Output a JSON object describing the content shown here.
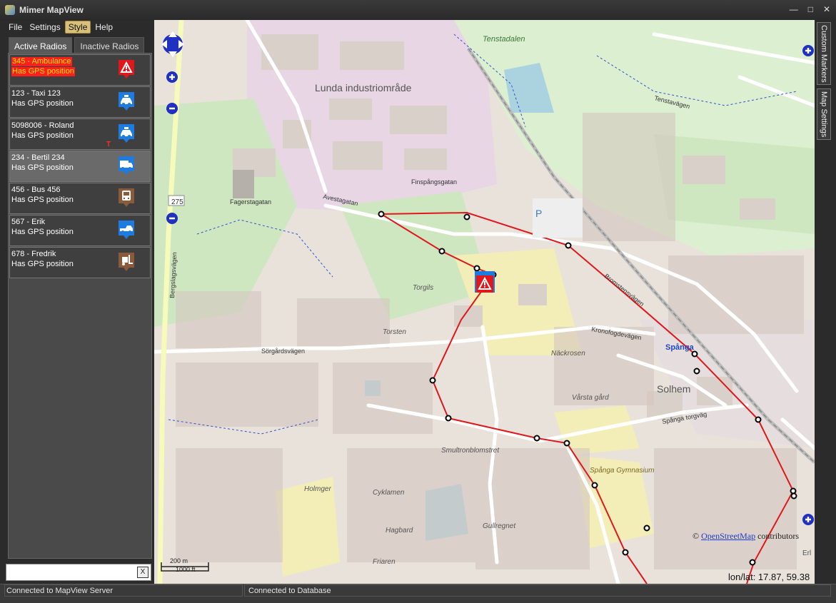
{
  "window": {
    "title": "Mimer MapView",
    "min_label": "—",
    "max_label": "□",
    "close_label": "✕"
  },
  "menu": {
    "file": "File",
    "settings": "Settings",
    "style": "Style",
    "help": "Help"
  },
  "tabs": {
    "active": "Active Radios",
    "inactive": "Inactive Radios"
  },
  "radios": [
    {
      "name": "345 - Ambulance",
      "status": "Has GPS position",
      "icon": "alarm-warning-icon",
      "alarm": true
    },
    {
      "name": "123 - Taxi 123",
      "status": "Has GPS position",
      "icon": "taxi-icon"
    },
    {
      "name": "5098006 - Roland",
      "status": "Has GPS position",
      "icon": "taxi-icon",
      "flag": "T"
    },
    {
      "name": "234 - Bertil 234",
      "status": "Has GPS position",
      "icon": "truck-icon",
      "selected": true
    },
    {
      "name": "456 - Bus 456",
      "status": "Has GPS position",
      "icon": "bus-icon"
    },
    {
      "name": "567 - Erik",
      "status": "Has GPS position",
      "icon": "pickup-icon"
    },
    {
      "name": "678 - Fredrik",
      "status": "Has GPS position",
      "icon": "forklift-icon"
    }
  ],
  "search": {
    "value": "",
    "clear_label": "X"
  },
  "map": {
    "labels": {
      "lunda": "Lunda industriområde",
      "tenstadalen": "Tenstadalen",
      "solhem": "Solhem",
      "spanga": "Spånga",
      "bergslagsvagen": "Bergslagsvägen",
      "avestagatan": "Avestagatan",
      "fagerstagatan": "Fagerstagatan",
      "finspangsgatan": "Finspångsgatan",
      "sorgardsvagen": "Sörgårdsvägen",
      "kronofogdevagen": "Kronofogdevägen",
      "tenstavagen": "Tenstavägen",
      "spanga_torgvag": "Spånga torgväg",
      "torsten": "Torsten",
      "torgils": "Torgils",
      "nackrosen": "Näckrosen",
      "vorsta_gard": "Vårsta gård",
      "smultronblomstret": "Smultronblomstret",
      "cyklamen": "Cyklamen",
      "holmger": "Holmger",
      "gullregnet": "Gullregnet",
      "hagbard": "Hagbard",
      "friaren": "Friaren",
      "spanga_gymnasium": "Spånga Gymnasium",
      "bromstensvagen": "Bromstensvägen",
      "road_number": "275",
      "parking": "P",
      "erlo": "Erl"
    },
    "attribution": {
      "prefix": "© ",
      "link": "OpenStreetMap",
      "suffix": " contributors"
    },
    "scale": {
      "metric": "200 m",
      "imperial": "1000 ft"
    },
    "coords": "lon/lat: 17.87, 59.38",
    "controls": {
      "zoom_in": "+",
      "zoom_out": "−"
    }
  },
  "side_tabs": {
    "custom_markers": "Custom Markers",
    "map_settings": "Map Settings"
  },
  "status": {
    "left": "Connected to MapView Server",
    "right": "Connected to Database"
  },
  "colors": {
    "alarm_bg": "#ff1e1e",
    "alarm_text": "#ffea00",
    "route": "#e0181c",
    "pin_blue": "#1e7be0",
    "pin_brown": "#8a5a3a"
  }
}
